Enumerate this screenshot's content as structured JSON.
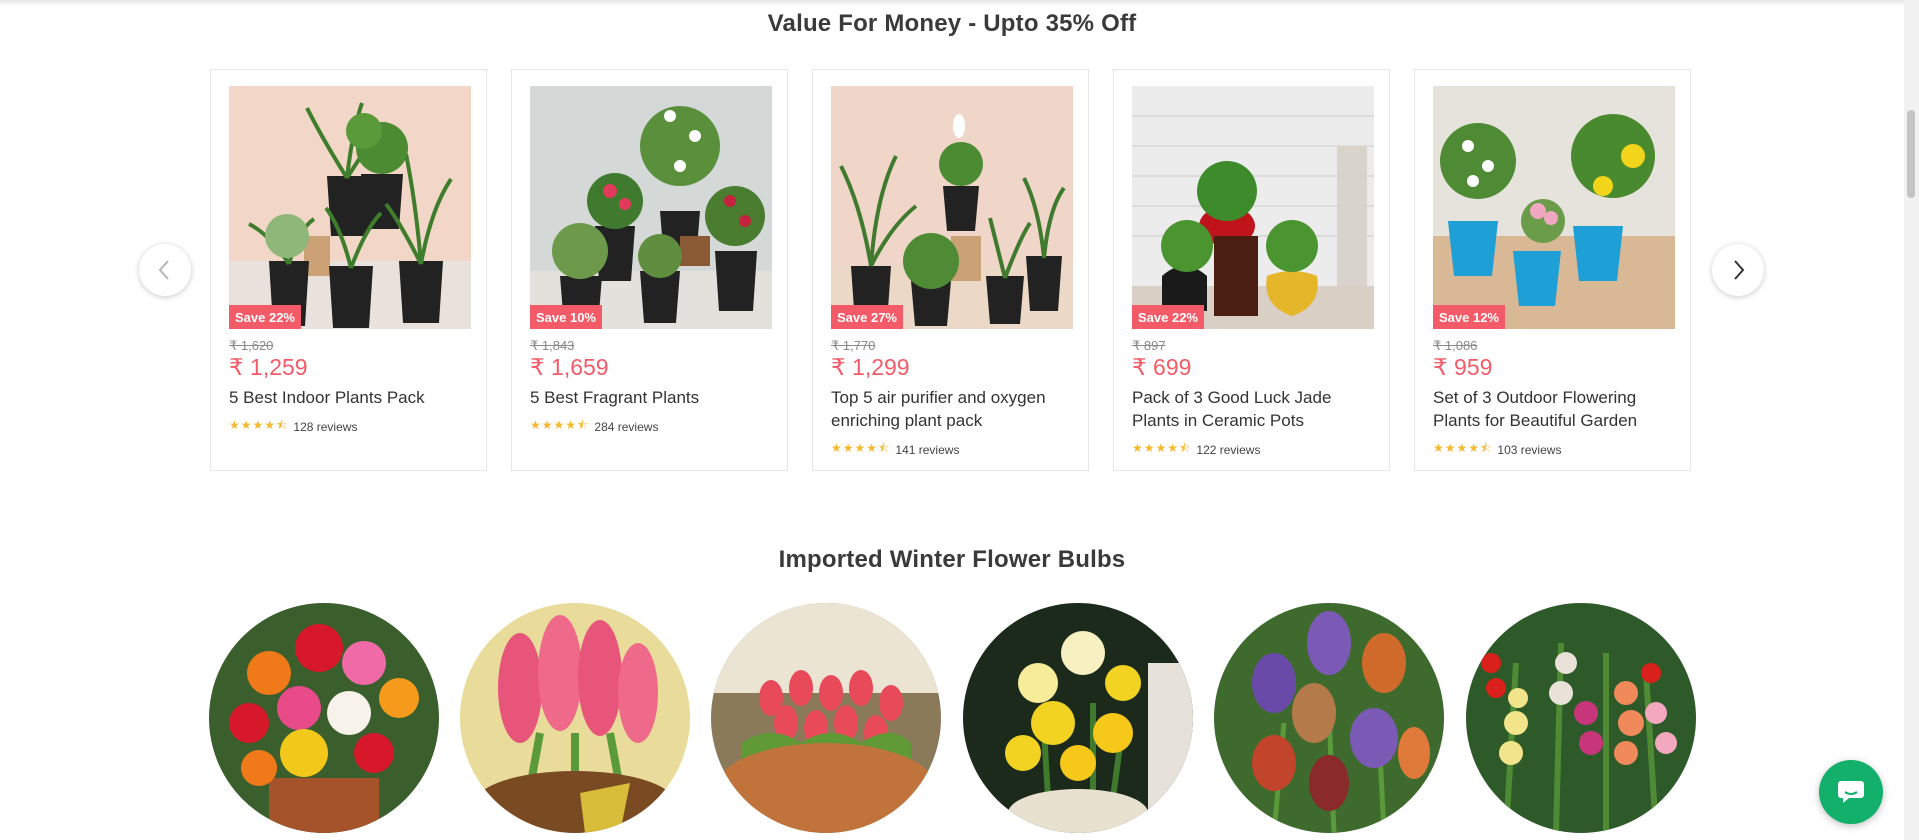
{
  "sections": {
    "value_title": "Value For Money - Upto 35% Off",
    "bulbs_title": "Imported Winter Flower Bulbs"
  },
  "carousel": {
    "prev_icon": "chevron-left-icon",
    "next_icon": "chevron-right-icon",
    "products": [
      {
        "save": "Save 22%",
        "old_price": "₹ 1,620",
        "price": "₹ 1,259",
        "name": "5 Best Indoor Plants Pack",
        "stars": "★★★★⯪",
        "reviews": "128 reviews",
        "rating": 4.5
      },
      {
        "save": "Save 10%",
        "old_price": "₹ 1,843",
        "price": "₹ 1,659",
        "name": "5 Best Fragrant Plants",
        "stars": "★★★★⯪",
        "reviews": "284 reviews",
        "rating": 4.5
      },
      {
        "save": "Save 27%",
        "old_price": "₹ 1,770",
        "price": "₹ 1,299",
        "name": "Top 5 air purifier and oxygen enriching plant pack",
        "stars": "★★★★⯪",
        "reviews": "141 reviews",
        "rating": 4.5
      },
      {
        "save": "Save 22%",
        "old_price": "₹ 897",
        "price": "₹ 699",
        "name": "Pack of 3 Good Luck Jade Plants in Ceramic Pots",
        "stars": "★★★★⯪",
        "reviews": "122 reviews",
        "rating": 4.5
      },
      {
        "save": "Save 12%",
        "old_price": "₹ 1,086",
        "price": "₹ 959",
        "name": "Set of 3 Outdoor Flowering Plants for Beautiful Garden",
        "stars": "★★★★⯪",
        "reviews": "103 reviews",
        "rating": 4.5
      }
    ]
  },
  "bulbs": [
    {
      "icon": "ranunculus-image"
    },
    {
      "icon": "hyacinth-image"
    },
    {
      "icon": "tulip-image"
    },
    {
      "icon": "daffodil-image"
    },
    {
      "icon": "iris-image"
    },
    {
      "icon": "gladiolus-image"
    }
  ],
  "colors": {
    "accent": "#f25b67",
    "star": "#f5b82e",
    "chat": "#12b06a"
  },
  "chat": {
    "icon": "chat-icon"
  }
}
